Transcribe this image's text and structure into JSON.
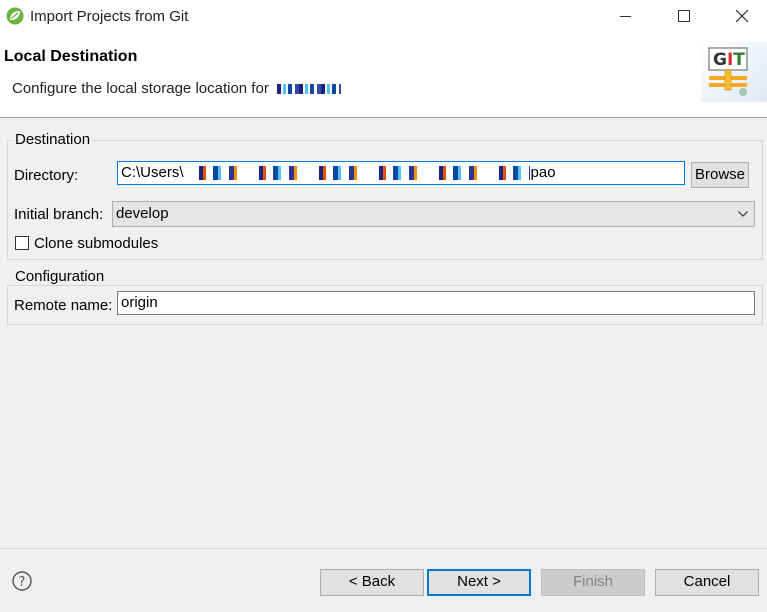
{
  "window": {
    "title": "Import Projects from Git",
    "icons": [
      "spring-leaf-icon",
      "minimize-icon",
      "maximize-icon",
      "close-icon"
    ]
  },
  "header": {
    "title": "Local Destination",
    "description": "Configure the local storage location for",
    "logo_text": "GIT"
  },
  "destination": {
    "group_label": "Destination",
    "directory_label": "Directory:",
    "directory_prefix": "C:\\Users\\",
    "directory_suffix": "pao",
    "browse_label": "Browse",
    "branch_label": "Initial branch:",
    "branch_value": "develop",
    "clone_submodules_label": "Clone submodules",
    "clone_submodules_checked": false
  },
  "configuration": {
    "group_label": "Configuration",
    "remote_label": "Remote name:",
    "remote_value": "origin"
  },
  "footer": {
    "back_label": "< Back",
    "next_label": "Next >",
    "finish_label": "Finish",
    "cancel_label": "Cancel",
    "help_icon": "help-icon"
  },
  "colors": {
    "accent": "#0078d7",
    "window_bg": "#f0f0f0",
    "disabled_text": "#838383"
  }
}
